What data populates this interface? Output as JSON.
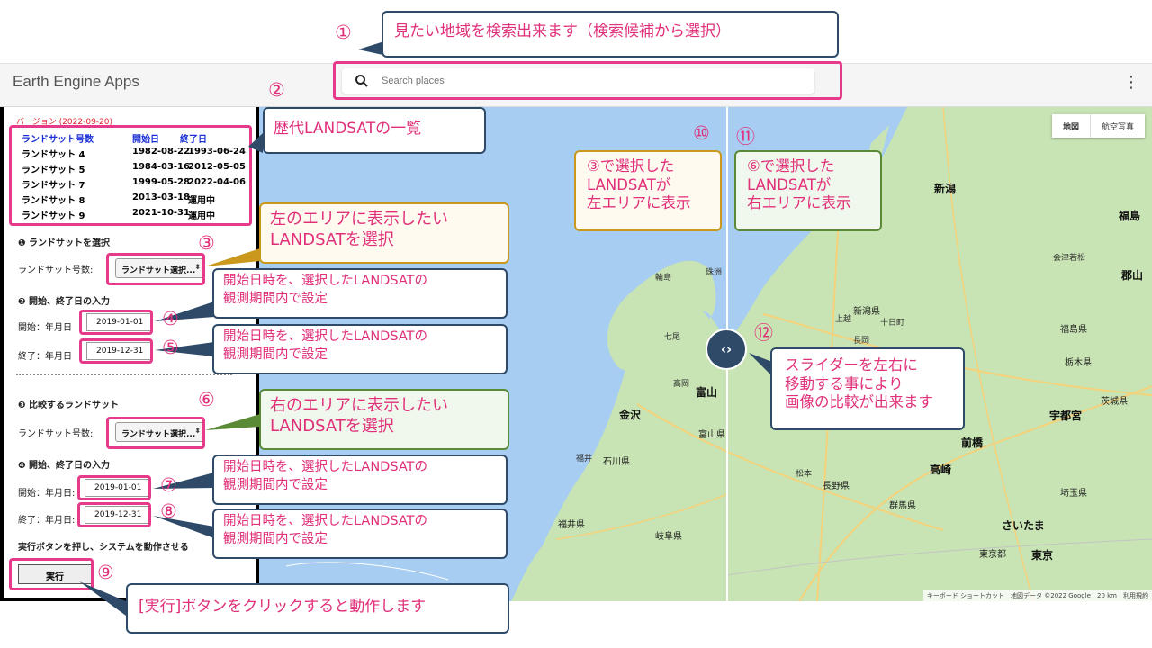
{
  "app": {
    "title": "Earth Engine Apps",
    "menu": "⋮"
  },
  "search": {
    "placeholder": "Search places",
    "icon": "search-icon"
  },
  "panel": {
    "version": "バージョン (2022-09-20)",
    "table_head": {
      "name": "ランドサット号数",
      "start": "開始日",
      "end": "終了日"
    },
    "landsats": [
      {
        "name": "ランドサット 4",
        "start": "1982-08-22",
        "end": "1993-06-24"
      },
      {
        "name": "ランドサット 5",
        "start": "1984-03-16",
        "end": "2012-05-05"
      },
      {
        "name": "ランドサット 7",
        "start": "1999-05-28",
        "end": "2022-04-06"
      },
      {
        "name": "ランドサット 8",
        "start": "2013-03-18",
        "end": "運用中"
      },
      {
        "name": "ランドサット 9",
        "start": "2021-10-31",
        "end": "運用中"
      }
    ],
    "sec1": "❶ ランドサットを選択",
    "sel_label": "ランドサット号数:",
    "sel_value": "ランドサット選択...",
    "sec2": "❷ 開始、終了日の入力",
    "start_label": "開始：年月日",
    "end_label": "終了：年月日",
    "start_label2": "開始：年月日:",
    "end_label2": "終了：年月日:",
    "start_date": "2019-01-01",
    "end_date": "2019-12-31",
    "sec3": "❸ 比較するランドサット",
    "sec4": "❹ 開始、終了日の入力",
    "run_text": "実行ボタンを押し、システムを動作させる",
    "run_button": "実行"
  },
  "map": {
    "type_map": "地図",
    "type_sat": "航空写真",
    "attribution": "キーボード ショートカット　地図データ ©2022 Google　20 km　利用規約",
    "places_big": [
      "新潟",
      "金沢",
      "富山",
      "前橋",
      "宇都宮",
      "さいたま",
      "東京",
      "高崎",
      "福島",
      "郡山"
    ],
    "places_mid": [
      "富山県",
      "石川県",
      "福井県",
      "岐阜県",
      "長野県",
      "新潟県",
      "福島県",
      "栃木県",
      "群馬県",
      "茨城県",
      "埼玉県",
      "東京都",
      "会津若松",
      "福井",
      "高岡",
      "七尾",
      "輪島",
      "珠洲",
      "上越",
      "長岡",
      "十日町",
      "松本",
      "岐阜",
      "岐阜"
    ]
  },
  "callouts": {
    "c1": "見たい地域を検索出来ます（検索候補から選択）",
    "c2": "歴代LANDSATの一覧",
    "c3": "左のエリアに表示したい\nLANDSATを選択",
    "c4": "開始日時を、選択したLANDSATの\n観測期間内で設定",
    "c6": "右のエリアに表示したい\nLANDSATを選択",
    "c9": "[実行]ボタンをクリックすると動作します",
    "c10": "③で選択した\nLANDSATが\n左エリアに表示",
    "c11": "⑥で選択した\nLANDSATが\n右エリアに表示",
    "c12": "スライダーを左右に\n移動する事により\n画像の比較が出来ます"
  },
  "numbers": [
    "①",
    "②",
    "③",
    "④",
    "⑤",
    "⑥",
    "⑦",
    "⑧",
    "⑨",
    "⑩",
    "⑪",
    "⑫"
  ],
  "colors": {
    "annotation": "#e0307a",
    "highlight": "#e53b8a",
    "callout_border": "#2f4a69",
    "water": "#a7cdf2",
    "land": "#c8e4b4"
  }
}
